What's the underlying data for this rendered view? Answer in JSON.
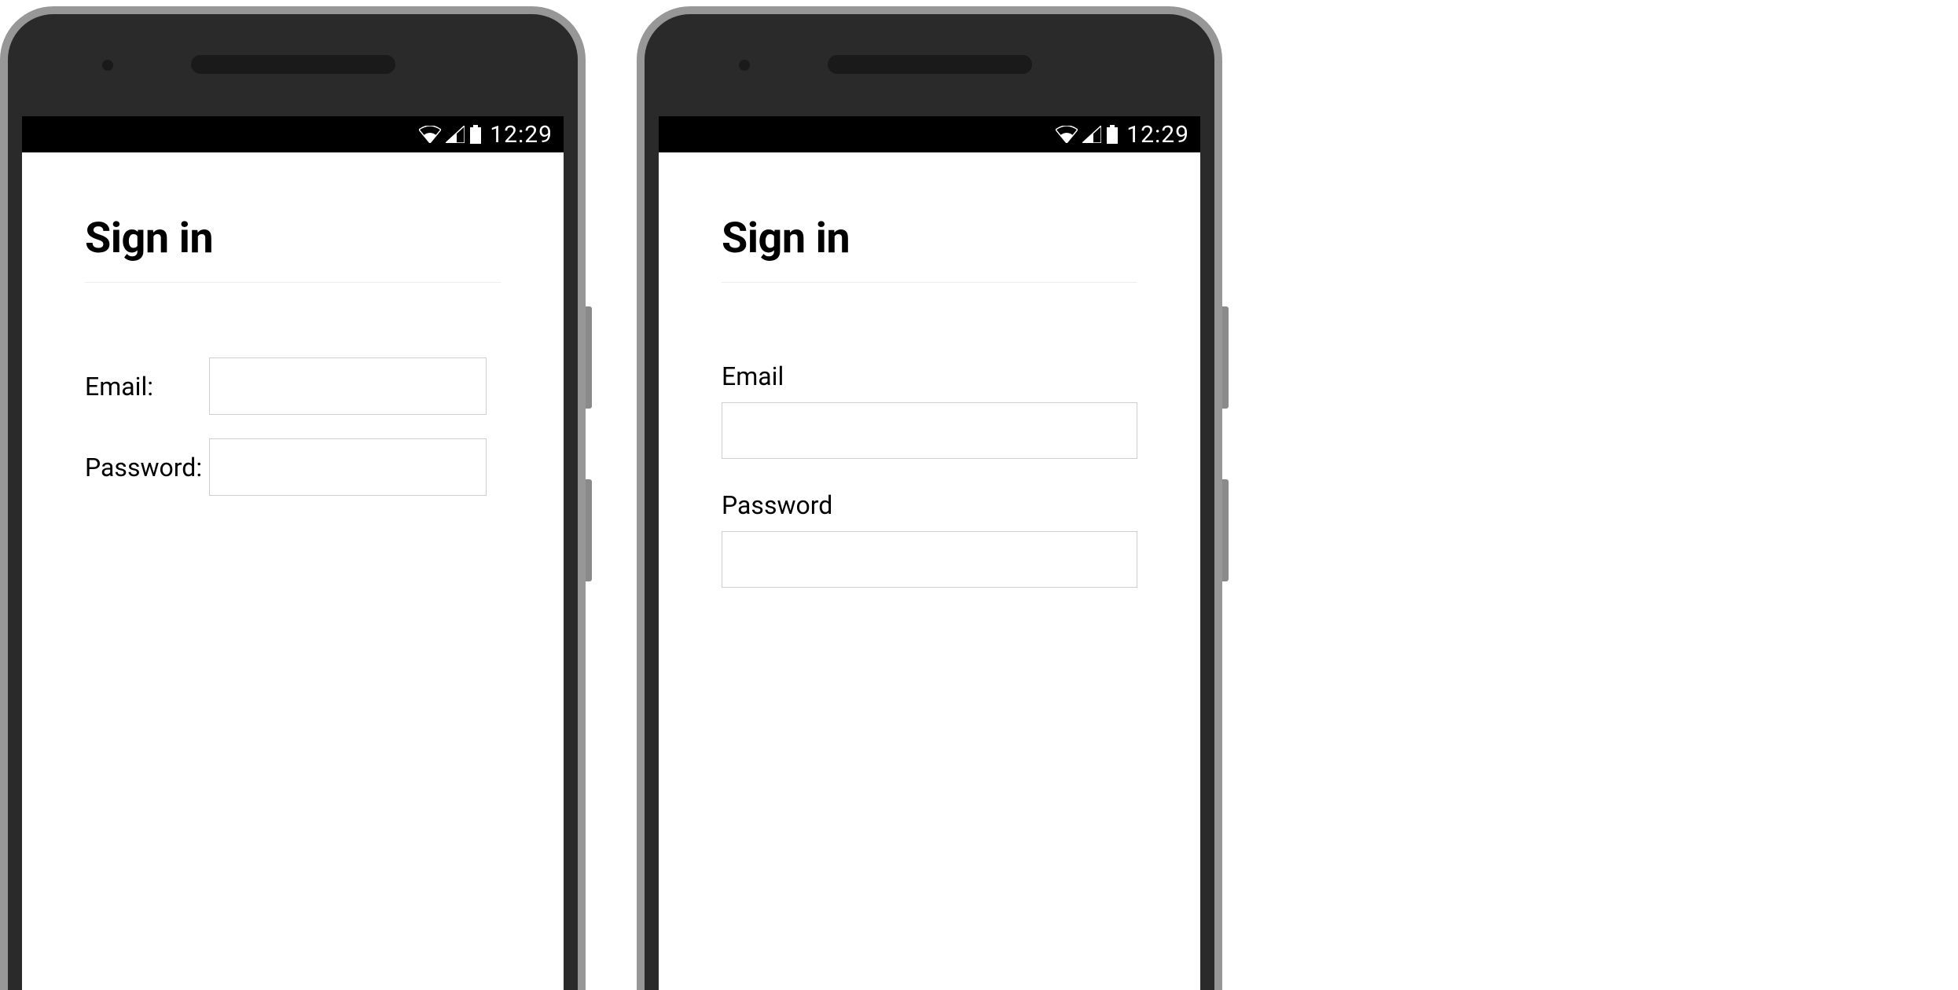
{
  "status_bar": {
    "time": "12:29"
  },
  "left_phone": {
    "title": "Sign in",
    "email_label": "Email:",
    "email_value": "",
    "password_label": "Password:",
    "password_value": ""
  },
  "right_phone": {
    "title": "Sign in",
    "email_label": "Email",
    "email_value": "",
    "password_label": "Password",
    "password_value": ""
  }
}
